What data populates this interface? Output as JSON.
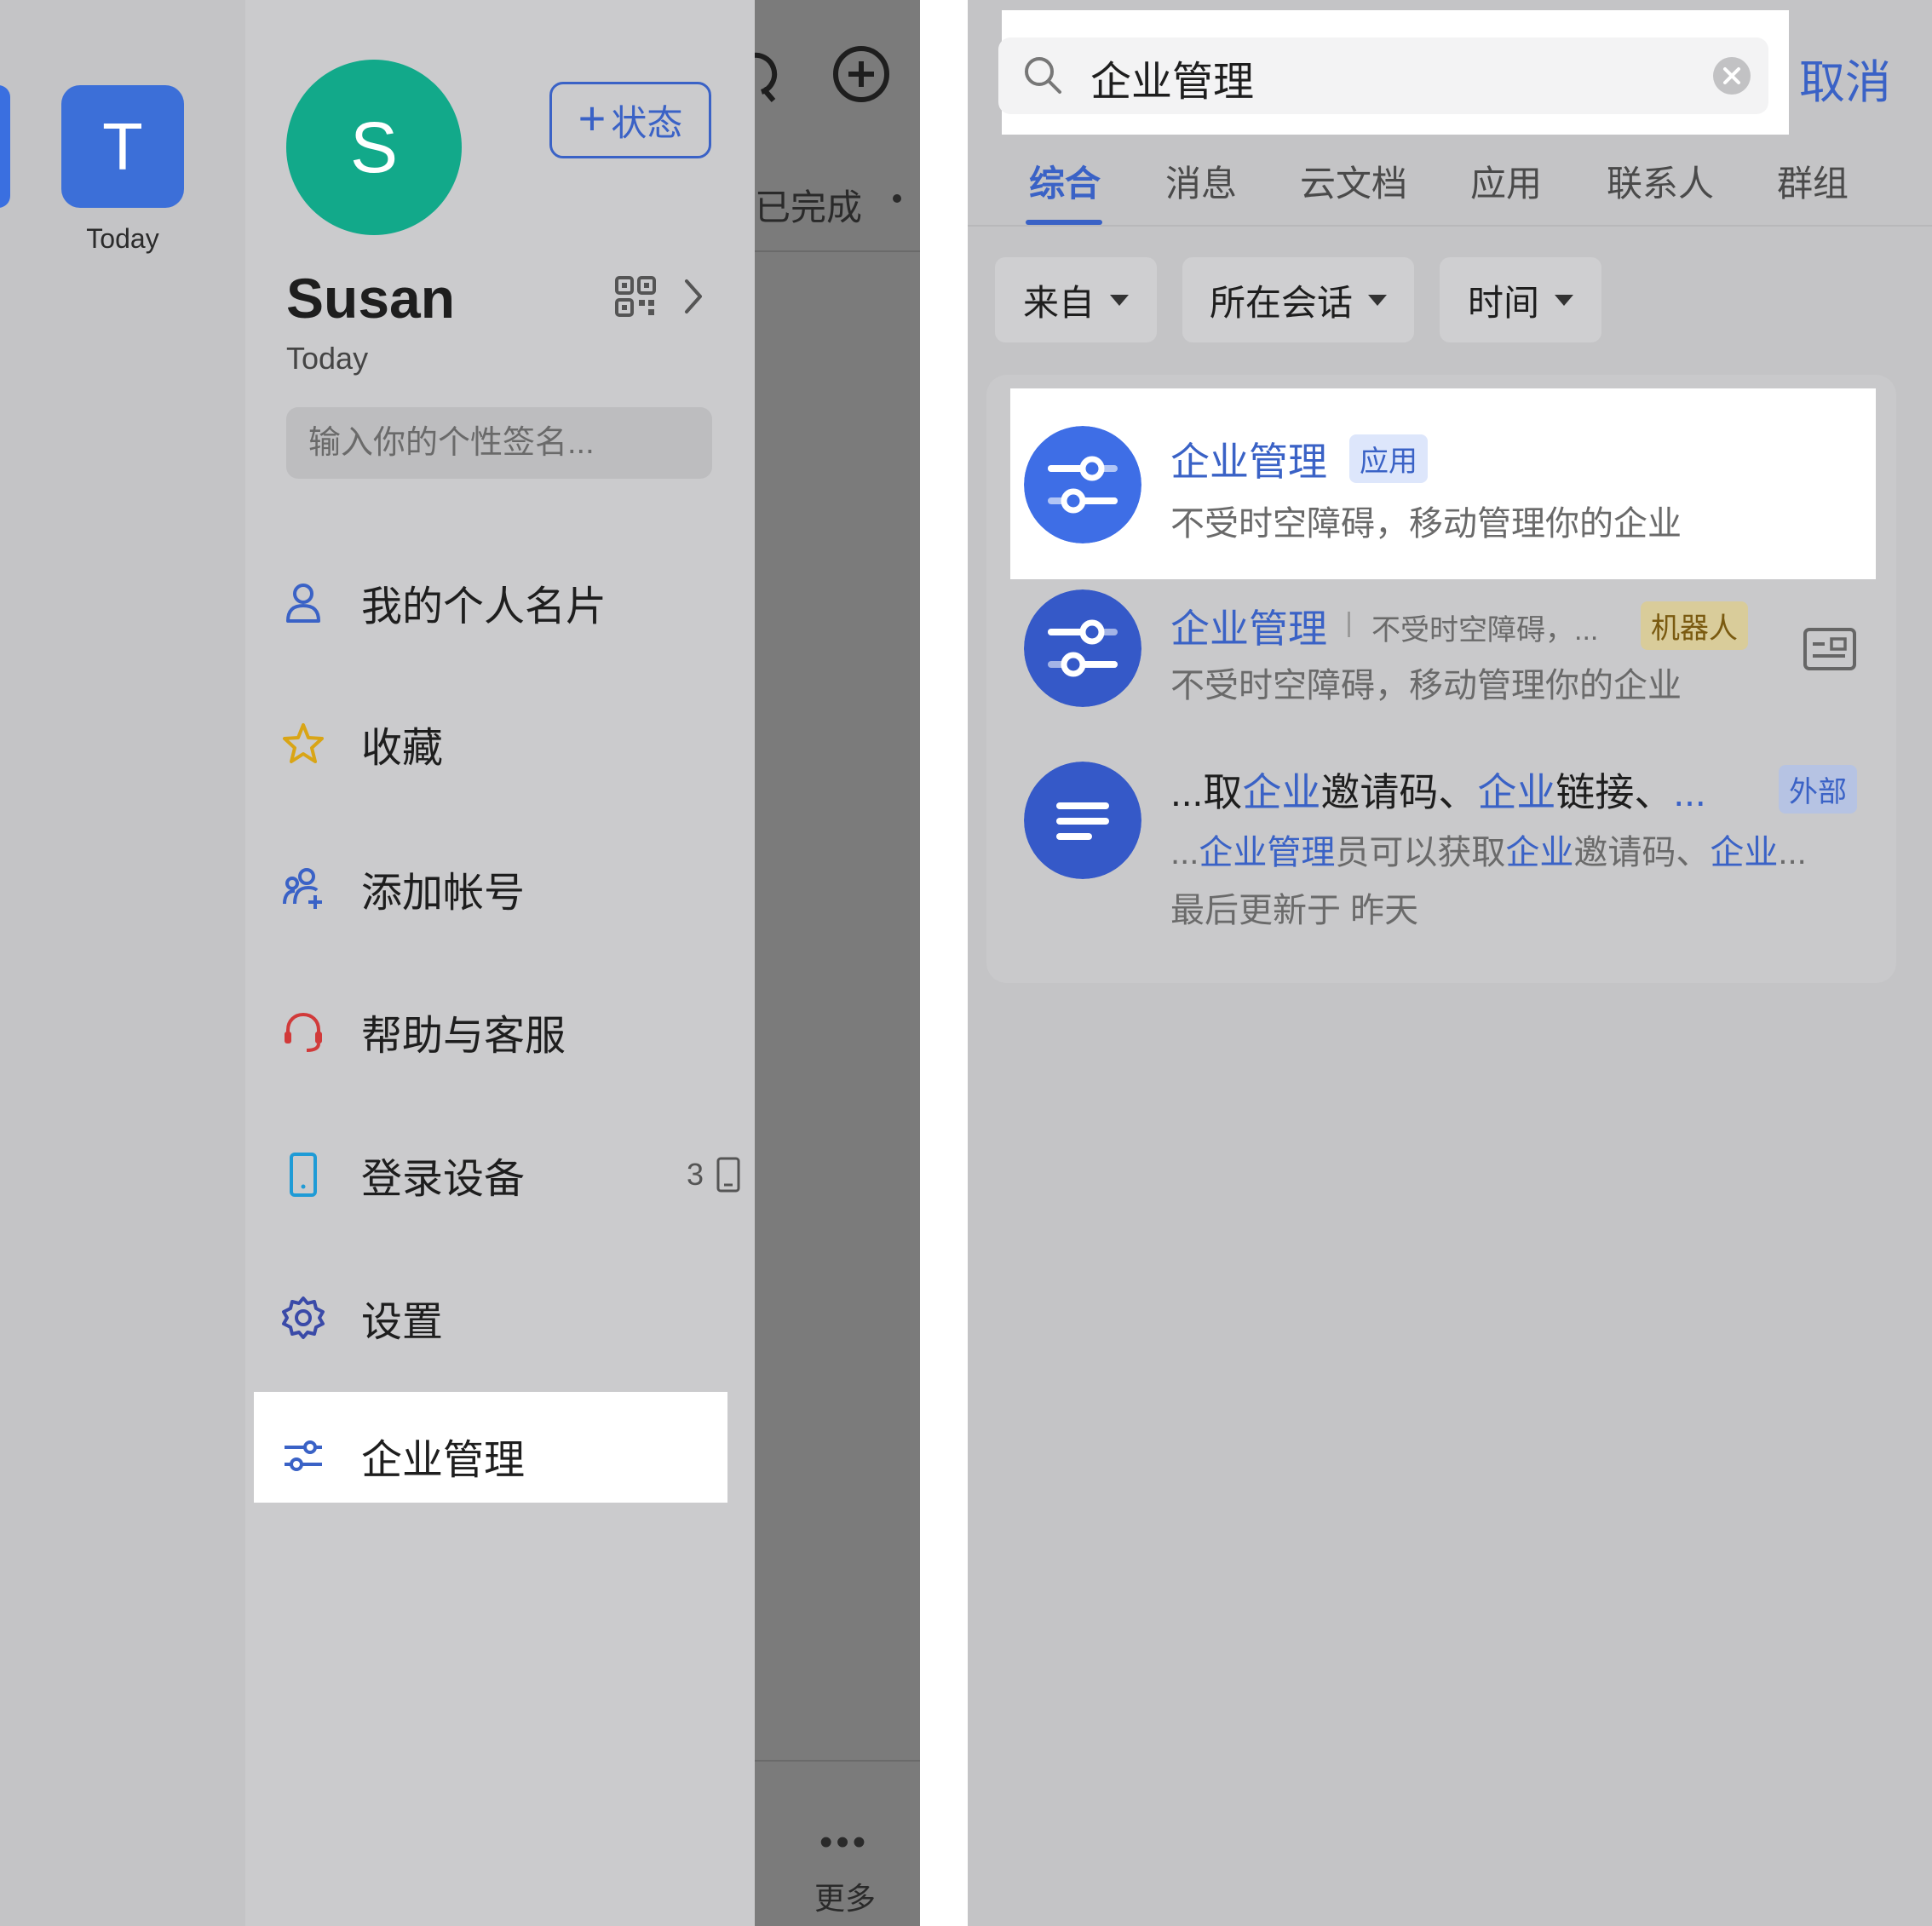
{
  "left": {
    "workspace": {
      "initial": "T",
      "label": "Today"
    },
    "profile": {
      "avatar_initial": "S",
      "status_button": "状态",
      "name": "Susan",
      "subtitle": "Today",
      "signature_placeholder": "输入你的个性签名..."
    },
    "menu": [
      {
        "label": "我的个人名片",
        "icon": "person-icon"
      },
      {
        "label": "收藏",
        "icon": "star-icon"
      },
      {
        "label": "添加帐号",
        "icon": "add-account-icon"
      },
      {
        "label": "帮助与客服",
        "icon": "headset-icon"
      },
      {
        "label": "登录设备",
        "icon": "phone-icon",
        "count": "3"
      },
      {
        "label": "设置",
        "icon": "gear-icon"
      },
      {
        "label": "企业管理",
        "icon": "sliders-icon"
      }
    ],
    "background": {
      "done_text": "已完成",
      "more_label": "更多"
    }
  },
  "right": {
    "search": {
      "value": "企业管理",
      "cancel": "取消"
    },
    "tabs": [
      "综合",
      "消息",
      "云文档",
      "应用",
      "联系人",
      "群组"
    ],
    "active_tab": "综合",
    "filters": [
      "来自",
      "所在会话",
      "时间"
    ],
    "results": [
      {
        "title": "企业管理",
        "tag": "应用",
        "subtitle": "不受时空障碍，移动管理你的企业"
      },
      {
        "title": "企业管理",
        "desc_short": "不受时空障碍，...",
        "tag": "机器人",
        "subtitle": "不受时空障碍，移动管理你的企业"
      },
      {
        "title_parts": [
          "...取",
          "企业",
          "邀请码、",
          "企业",
          "链接、",
          "..."
        ],
        "tag": "外部",
        "snippet_parts": [
          "...",
          "企业管理",
          "员可以获取",
          "企业",
          "邀请码、",
          "企业",
          "..."
        ],
        "updated": "最后更新于 昨天"
      }
    ]
  },
  "colors": {
    "accent": "#3a62c6",
    "avatar": "#12a98a",
    "workspace_tile": "#3c6fd8",
    "result_icon": "#3e6ee6"
  }
}
